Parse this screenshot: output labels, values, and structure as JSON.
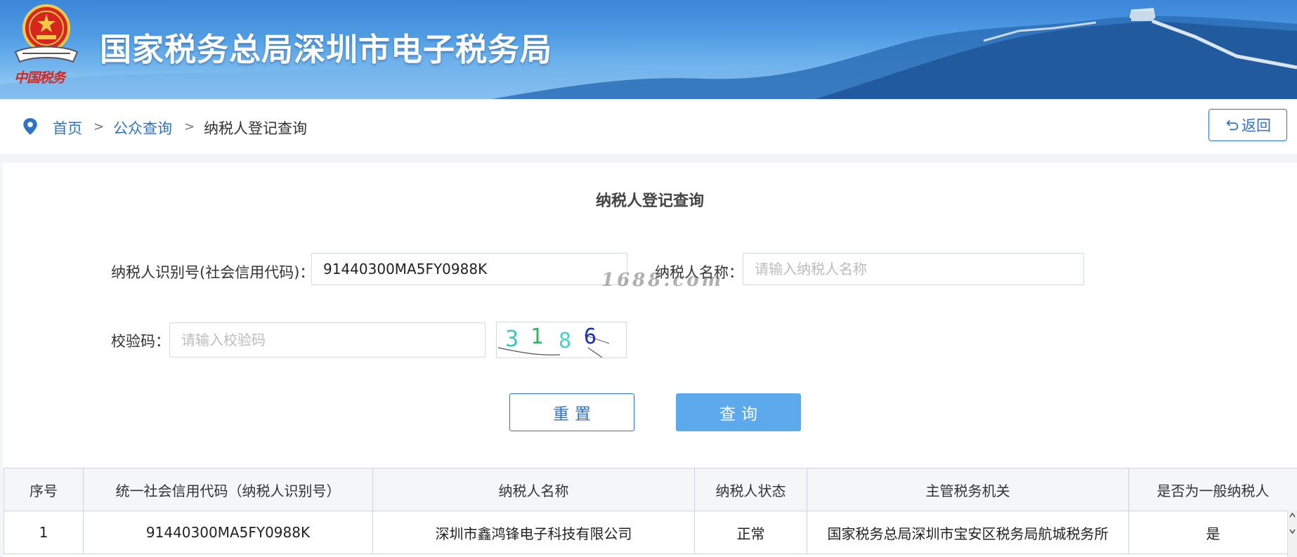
{
  "header": {
    "site_title": "国家税务总局深圳市电子税务局",
    "emblem_caption": "中国税务"
  },
  "breadcrumb": {
    "items": [
      {
        "label": "首页",
        "link": true
      },
      {
        "label": "公众查询",
        "link": true
      },
      {
        "label": "纳税人登记查询",
        "link": false
      }
    ],
    "separator": ">",
    "back_label": "返回",
    "back_icon": "return-arrow-icon"
  },
  "form": {
    "title": "纳税人登记查询",
    "taxpayer_id": {
      "label": "纳税人识别号(社会信用代码)：",
      "value": "91440300MA5FY0988K"
    },
    "taxpayer_name": {
      "label": "纳税人名称：",
      "placeholder": "请输入纳税人名称"
    },
    "captcha": {
      "label": "校验码：",
      "placeholder": "请输入校验码",
      "image_text": [
        "3",
        "1",
        "8",
        "6"
      ]
    },
    "reset_label": "重置",
    "query_label": "查询",
    "watermark": "1688.com"
  },
  "table": {
    "columns": [
      "序号",
      "统一社会信用代码（纳税人识别号）",
      "纳税人名称",
      "纳税人状态",
      "主管税务机关",
      "是否为一般纳税人"
    ],
    "rows": [
      [
        "1",
        "91440300MA5FY0988K",
        "深圳市鑫鸿锋电子科技有限公司",
        "正常",
        "国家税务总局深圳市宝安区税务局航城税务所",
        "是"
      ]
    ]
  },
  "colors": {
    "accent": "#2f73c9",
    "query_button": "#5ca9ec"
  }
}
